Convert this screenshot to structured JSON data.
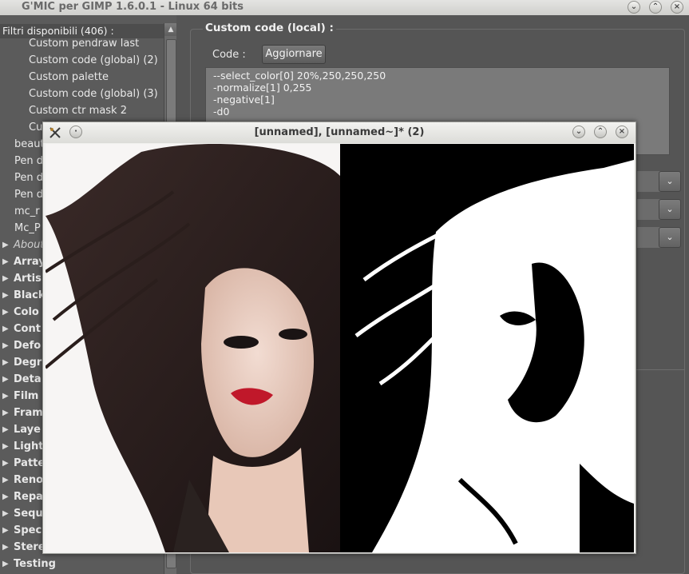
{
  "window": {
    "title": "G'MIC per GIMP 1.6.0.1 - Linux 64 bits"
  },
  "filters": {
    "header": "Filtri disponibili (406) :",
    "items": [
      {
        "label": "Custom pendraw last",
        "type": "leaf",
        "indent": 2
      },
      {
        "label": "Custom code (global) (2)",
        "type": "leaf",
        "indent": 2
      },
      {
        "label": "Custom palette",
        "type": "leaf",
        "indent": 2
      },
      {
        "label": "Custom code (global) (3)",
        "type": "leaf",
        "indent": 2
      },
      {
        "label": "Custom ctr mask 2",
        "type": "leaf",
        "indent": 2
      },
      {
        "label": "Cu",
        "type": "leaf",
        "indent": 2
      },
      {
        "label": "beaut",
        "type": "leaf",
        "indent": 1
      },
      {
        "label": "Pen d",
        "type": "leaf",
        "indent": 1
      },
      {
        "label": "Pen d",
        "type": "leaf",
        "indent": 1
      },
      {
        "label": "Pen d",
        "type": "leaf",
        "indent": 1
      },
      {
        "label": "mc_r",
        "type": "leaf",
        "indent": 1
      },
      {
        "label": "Mc_P",
        "type": "leaf",
        "indent": 1
      },
      {
        "label": "About",
        "type": "folder",
        "italic": true
      },
      {
        "label": "Array",
        "type": "folder"
      },
      {
        "label": "Artis",
        "type": "folder"
      },
      {
        "label": "Black",
        "type": "folder"
      },
      {
        "label": "Colo",
        "type": "folder"
      },
      {
        "label": "Cont",
        "type": "folder"
      },
      {
        "label": "Defo",
        "type": "folder"
      },
      {
        "label": "Degr",
        "type": "folder"
      },
      {
        "label": "Deta",
        "type": "folder"
      },
      {
        "label": "Film",
        "type": "folder"
      },
      {
        "label": "Fram",
        "type": "folder"
      },
      {
        "label": "Laye",
        "type": "folder"
      },
      {
        "label": "Light",
        "type": "folder"
      },
      {
        "label": "Patte",
        "type": "folder"
      },
      {
        "label": "Reno",
        "type": "folder"
      },
      {
        "label": "Repa",
        "type": "folder"
      },
      {
        "label": "Sequ",
        "type": "folder"
      },
      {
        "label": "Spec",
        "type": "folder"
      },
      {
        "label": "Stere",
        "type": "folder"
      },
      {
        "label": "Testing",
        "type": "folder"
      }
    ]
  },
  "filter_panel": {
    "title": "Custom code (local) :",
    "code_label": "Code :",
    "update_button": "Aggiornare",
    "code_lines": [
      "--select_color[0]  20%,250,250,250",
      "-normalize[1] 0,255",
      "-negative[1]",
      "-d0"
    ]
  },
  "preview_window": {
    "title": "[unnamed], [unnamed~]* (2)"
  },
  "colors": {
    "panel_bg": "#5a5a5a",
    "titlebar": "#dcdcd8",
    "code_bg": "#7a7a7a"
  }
}
